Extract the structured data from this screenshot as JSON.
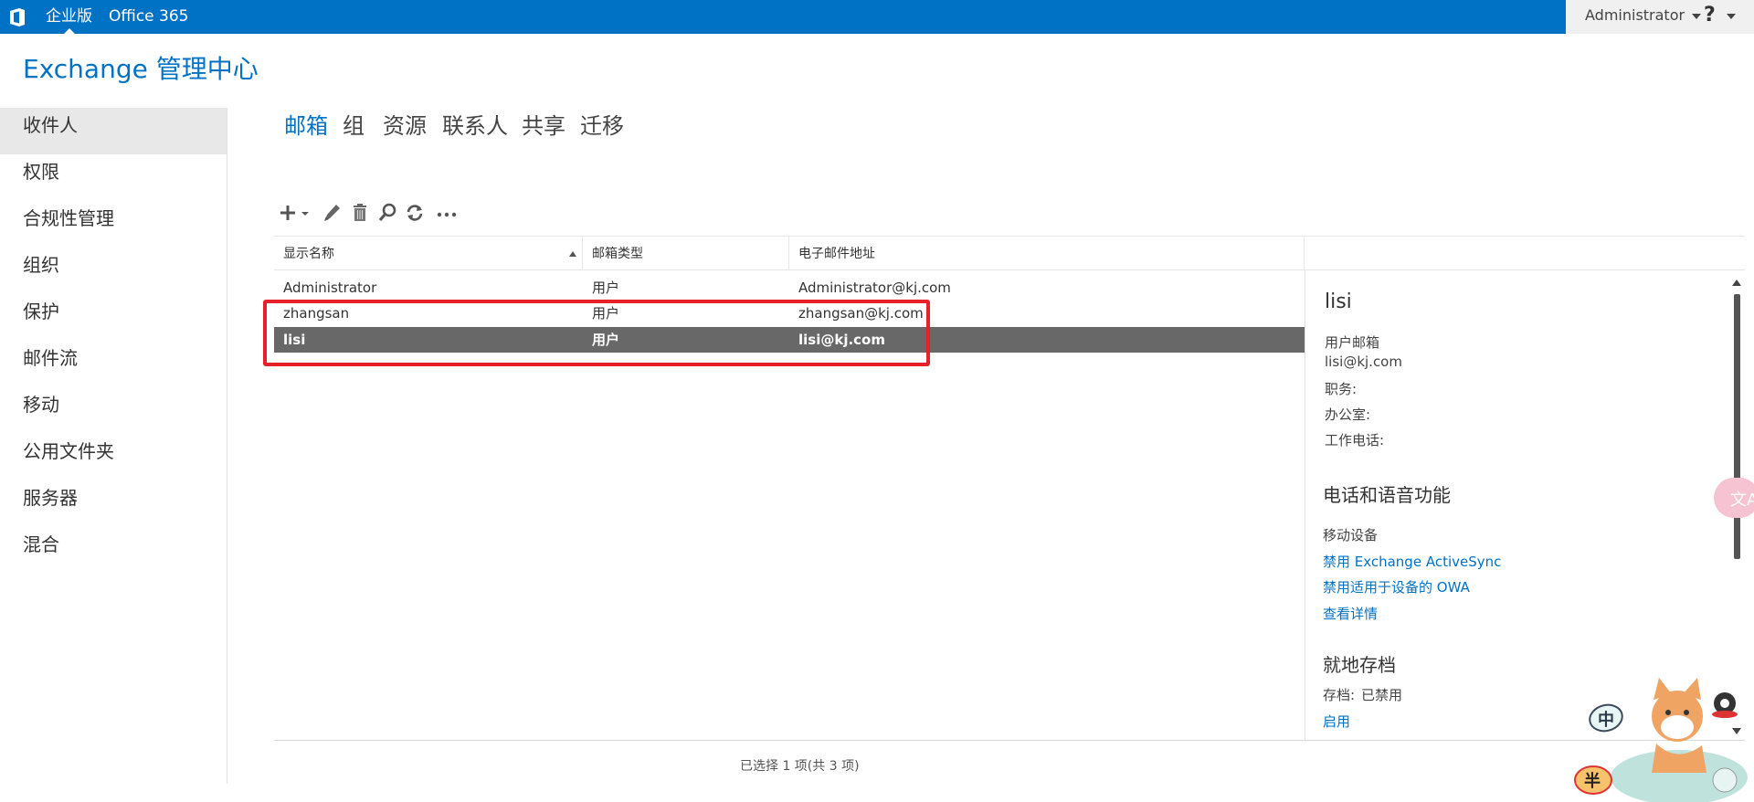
{
  "topbar": {
    "brand_label": "企业版",
    "office_label": "Office 365",
    "user_label": "Administrator",
    "help_label": "?"
  },
  "app_title": "Exchange 管理中心",
  "leftnav": {
    "items": [
      {
        "label": "收件人",
        "active": true
      },
      {
        "label": "权限"
      },
      {
        "label": "合规性管理"
      },
      {
        "label": "组织"
      },
      {
        "label": "保护"
      },
      {
        "label": "邮件流"
      },
      {
        "label": "移动"
      },
      {
        "label": "公用文件夹"
      },
      {
        "label": "服务器"
      },
      {
        "label": "混合"
      }
    ]
  },
  "tabs": [
    {
      "label": "邮箱",
      "active": true
    },
    {
      "label": "组"
    },
    {
      "label": "资源"
    },
    {
      "label": "联系人"
    },
    {
      "label": "共享"
    },
    {
      "label": "迁移"
    }
  ],
  "toolbar": {
    "icons": [
      "add-icon",
      "edit-icon",
      "delete-icon",
      "search-icon",
      "refresh-icon",
      "more-icon"
    ]
  },
  "grid": {
    "columns": [
      "显示名称",
      "邮箱类型",
      "电子邮件地址"
    ],
    "rows": [
      {
        "name": "Administrator",
        "type": "用户",
        "email": "Administrator@kj.com"
      },
      {
        "name": "zhangsan",
        "type": "用户",
        "email": "zhangsan@kj.com"
      },
      {
        "name": "lisi",
        "type": "用户",
        "email": "lisi@kj.com",
        "selected": true
      }
    ]
  },
  "details": {
    "name": "lisi",
    "mailbox_type_label": "用户邮箱",
    "email": "lisi@kj.com",
    "title_label": "职务:",
    "office_label": "办公室:",
    "work_phone_label": "工作电话:",
    "phone_voice_heading": "电话和语音功能",
    "mobile_devices_label": "移动设备",
    "disable_activesync_link": "禁用 Exchange ActiveSync",
    "disable_owa_link": "禁用适用于设备的 OWA",
    "view_details_link": "查看详情",
    "inplace_archive_heading": "就地存档",
    "archive_label": "存档:",
    "archive_value": "已禁用",
    "enable_link": "启用"
  },
  "status_text": "已选择 1 项(共 3 项)",
  "overlay": {
    "translate_glyph": "文A",
    "mascot_chars": [
      "中",
      "半"
    ]
  },
  "colors": {
    "accent": "#0072c6",
    "selected_row": "#686868",
    "highlight": "#e8202a"
  }
}
